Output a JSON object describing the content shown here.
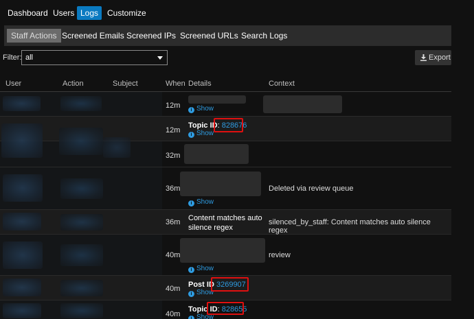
{
  "nav": {
    "dashboard": "Dashboard",
    "users": "Users",
    "logs": "Logs",
    "customize": "Customize"
  },
  "subnav": {
    "staff_actions": "Staff Actions",
    "screened_emails": "Screened Emails",
    "screened_ips": "Screened IPs",
    "screened_urls": "Screened URLs",
    "search_logs": "Search Logs"
  },
  "filter": {
    "label": "Filter:",
    "value": "all"
  },
  "export": {
    "label": "Export"
  },
  "columns": {
    "user": "User",
    "action": "Action",
    "subject": "Subject",
    "when": "When",
    "details": "Details",
    "context": "Context"
  },
  "show_label": "Show",
  "rows": [
    {
      "when": "12m",
      "details_label": "",
      "details_value": "",
      "context": ""
    },
    {
      "when": "12m",
      "details_label": "Topic ID",
      "details_value": "828676",
      "context": ""
    },
    {
      "when": "32m",
      "details_label": "",
      "details_value": "",
      "context": ""
    },
    {
      "when": "36m",
      "details_label": "",
      "details_value": "",
      "context": "Deleted via review queue"
    },
    {
      "when": "36m",
      "details_line1": "Content matches auto",
      "details_line2": "silence regex",
      "context": "silenced_by_staff: Content matches auto silence regex"
    },
    {
      "when": "40m",
      "details_label": "",
      "details_value": "",
      "context": "review"
    },
    {
      "when": "40m",
      "details_label": "Post ID",
      "details_value": "3269907",
      "context": ""
    },
    {
      "when": "40m",
      "details_label": "Topic ID",
      "details_value": "828655",
      "context": ""
    }
  ],
  "colors": {
    "accent": "#0a7ac1",
    "link": "#2e9be0",
    "highlight_box": "#e01010"
  }
}
